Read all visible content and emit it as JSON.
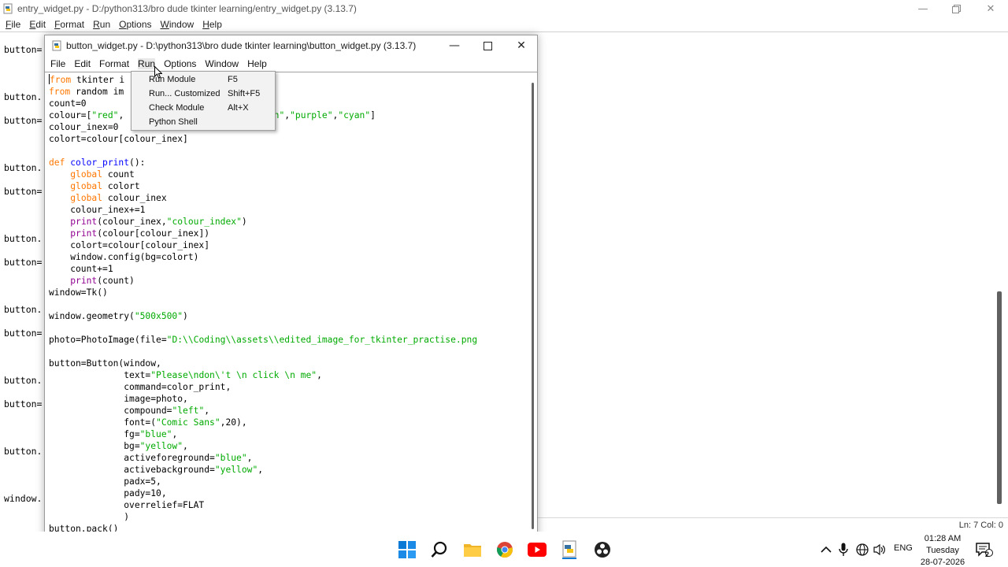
{
  "background_window": {
    "title": "entry_widget.py - D:/python313/bro dude tkinter learning/entry_widget.py (3.13.7)",
    "menu": [
      "File",
      "Edit",
      "Format",
      "Run",
      "Options",
      "Window",
      "Help"
    ],
    "code_fragments": [
      "button=",
      "button.",
      "button=",
      "button.",
      "button=",
      "button.",
      "button=",
      "button.",
      "button=",
      "button.",
      "button=",
      "button.",
      "window."
    ],
    "status": "Ln: 7   Col: 0"
  },
  "foreground_window": {
    "title": "button_widget.py - D:\\python313\\bro dude tkinter learning\\button_widget.py (3.13.7)",
    "menu": [
      "File",
      "Edit",
      "Format",
      "Run",
      "Options",
      "Window",
      "Help"
    ],
    "active_menu": "Run"
  },
  "run_menu": {
    "items": [
      {
        "label": "Run Module",
        "shortcut": "F5"
      },
      {
        "label": "Run... Customized",
        "shortcut": "Shift+F5"
      },
      {
        "label": "Check Module",
        "shortcut": "Alt+X"
      },
      {
        "label": "Python Shell",
        "shortcut": ""
      }
    ]
  },
  "code": [
    [
      [
        "kw",
        "from"
      ],
      [
        "tx",
        " tkinter i"
      ]
    ],
    [
      [
        "kw",
        "from"
      ],
      [
        "tx",
        " random im"
      ]
    ],
    [
      [
        "tx",
        "count=0"
      ]
    ],
    [
      [
        "tx",
        "colour=["
      ],
      [
        "st",
        "\"red\""
      ],
      [
        "tx",
        ",                      ,"
      ],
      [
        "st",
        "\"brown\""
      ],
      [
        "tx",
        ","
      ],
      [
        "st",
        "\"purple\""
      ],
      [
        "tx",
        ","
      ],
      [
        "st",
        "\"cyan\""
      ],
      [
        "tx",
        "]"
      ]
    ],
    [
      [
        "tx",
        "colour_inex=0"
      ]
    ],
    [
      [
        "tx",
        "colort=colour[colour_inex]"
      ]
    ],
    [],
    [
      [
        "kw",
        "def"
      ],
      [
        "tx",
        " "
      ],
      [
        "df",
        "color_print"
      ],
      [
        "tx",
        "():"
      ]
    ],
    [
      [
        "tx",
        "    "
      ],
      [
        "kw",
        "global"
      ],
      [
        "tx",
        " count"
      ]
    ],
    [
      [
        "tx",
        "    "
      ],
      [
        "kw",
        "global"
      ],
      [
        "tx",
        " colort"
      ]
    ],
    [
      [
        "tx",
        "    "
      ],
      [
        "kw",
        "global"
      ],
      [
        "tx",
        " colour_inex"
      ]
    ],
    [
      [
        "tx",
        "    colour_inex+=1"
      ]
    ],
    [
      [
        "tx",
        "    "
      ],
      [
        "bi",
        "print"
      ],
      [
        "tx",
        "(colour_inex,"
      ],
      [
        "st",
        "\"colour_index\""
      ],
      [
        "tx",
        ")"
      ]
    ],
    [
      [
        "tx",
        "    "
      ],
      [
        "bi",
        "print"
      ],
      [
        "tx",
        "(colour[colour_inex])"
      ]
    ],
    [
      [
        "tx",
        "    colort=colour[colour_inex]"
      ]
    ],
    [
      [
        "tx",
        "    window.config(bg=colort)"
      ]
    ],
    [
      [
        "tx",
        "    count+=1"
      ]
    ],
    [
      [
        "tx",
        "    "
      ],
      [
        "bi",
        "print"
      ],
      [
        "tx",
        "(count)"
      ]
    ],
    [
      [
        "tx",
        "window=Tk()"
      ]
    ],
    [],
    [
      [
        "tx",
        "window.geometry("
      ],
      [
        "st",
        "\"500x500\""
      ],
      [
        "tx",
        ")"
      ]
    ],
    [],
    [
      [
        "tx",
        "photo=PhotoImage(file="
      ],
      [
        "st",
        "\"D:\\\\Coding\\\\assets\\\\edited_image_for_tkinter_practise.png"
      ]
    ],
    [],
    [
      [
        "tx",
        "button=Button(window,"
      ]
    ],
    [
      [
        "tx",
        "              text="
      ],
      [
        "st",
        "\"Please\\ndon\\'t \\n click \\n me\""
      ],
      [
        "tx",
        ","
      ]
    ],
    [
      [
        "tx",
        "              command=color_print,"
      ]
    ],
    [
      [
        "tx",
        "              image=photo,"
      ]
    ],
    [
      [
        "tx",
        "              compound="
      ],
      [
        "st",
        "\"left\""
      ],
      [
        "tx",
        ","
      ]
    ],
    [
      [
        "tx",
        "              font=("
      ],
      [
        "st",
        "\"Comic Sans\""
      ],
      [
        "tx",
        ",20),"
      ]
    ],
    [
      [
        "tx",
        "              fg="
      ],
      [
        "st",
        "\"blue\""
      ],
      [
        "tx",
        ","
      ]
    ],
    [
      [
        "tx",
        "              bg="
      ],
      [
        "st",
        "\"yellow\""
      ],
      [
        "tx",
        ","
      ]
    ],
    [
      [
        "tx",
        "              activeforeground="
      ],
      [
        "st",
        "\"blue\""
      ],
      [
        "tx",
        ","
      ]
    ],
    [
      [
        "tx",
        "              activebackground="
      ],
      [
        "st",
        "\"yellow\""
      ],
      [
        "tx",
        ","
      ]
    ],
    [
      [
        "tx",
        "              padx=5,"
      ]
    ],
    [
      [
        "tx",
        "              pady=10,"
      ]
    ],
    [
      [
        "tx",
        "              overrelief=FLAT"
      ]
    ],
    [
      [
        "tx",
        "              )"
      ]
    ],
    [
      [
        "tx",
        "button.pack()"
      ]
    ]
  ],
  "taskbar": {
    "tray_lang": "ENG",
    "time": "01:28 AM",
    "day": "Tuesday",
    "date": "28-07-2026",
    "notification_count": "2"
  },
  "colors": {
    "keyword": "#ff7700",
    "builtin": "#900090",
    "string": "#00aa00",
    "definition": "#0000ff"
  }
}
